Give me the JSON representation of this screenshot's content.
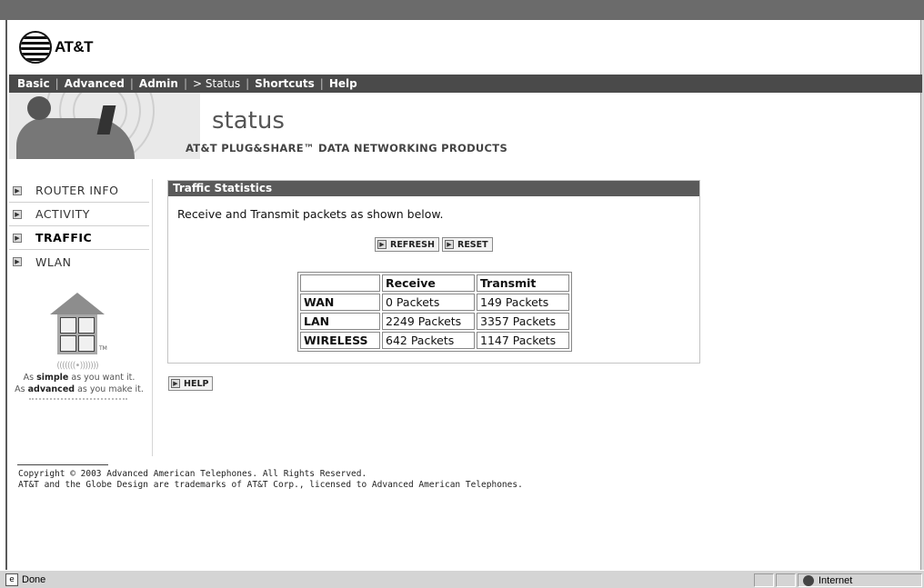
{
  "brand": {
    "logo_text": "AT&T"
  },
  "nav": {
    "items": [
      {
        "label": "Basic"
      },
      {
        "label": "Advanced"
      },
      {
        "label": "Admin"
      },
      {
        "label": "> Status"
      },
      {
        "label": "Shortcuts"
      },
      {
        "label": "Help"
      }
    ],
    "separator": "|"
  },
  "banner": {
    "title": "status",
    "subtitle": "AT&T PLUG&SHARE™ DATA NETWORKING PRODUCTS"
  },
  "sidebar": {
    "items": [
      {
        "label": "ROUTER INFO"
      },
      {
        "label": "ACTIVITY"
      },
      {
        "label": "TRAFFIC"
      },
      {
        "label": "WLAN"
      }
    ],
    "active": "TRAFFIC",
    "tm": "TM",
    "signal": "(((((((•)))))))",
    "tagline1_pre": "As ",
    "tagline1_bold": "simple",
    "tagline1_post": " as you want it.",
    "tagline2_pre": "As ",
    "tagline2_bold": "advanced",
    "tagline2_post": " as you make it."
  },
  "panel": {
    "header": "Traffic Statistics",
    "description": "Receive and Transmit packets as shown below.",
    "refresh_label": "REFRESH",
    "reset_label": "RESET"
  },
  "table": {
    "columns": [
      "",
      "Receive",
      "Transmit"
    ],
    "rows": [
      {
        "label": "WAN",
        "receive": "0 Packets",
        "transmit": "149 Packets"
      },
      {
        "label": "LAN",
        "receive": "2249 Packets",
        "transmit": "3357 Packets"
      },
      {
        "label": "WIRELESS",
        "receive": "642 Packets",
        "transmit": "1147 Packets"
      }
    ]
  },
  "help_label": "HELP",
  "footer": {
    "line1": "Copyright © 2003 Advanced American Telephones. All Rights Reserved.",
    "line2": "AT&T and the Globe Design are trademarks of AT&T Corp., licensed to Advanced American Telephones."
  },
  "statusbar": {
    "status": "Done",
    "zone": "Internet"
  },
  "colors": {
    "nav_bg": "#4a4a4a",
    "panel_header_bg": "#5a5a5a"
  }
}
